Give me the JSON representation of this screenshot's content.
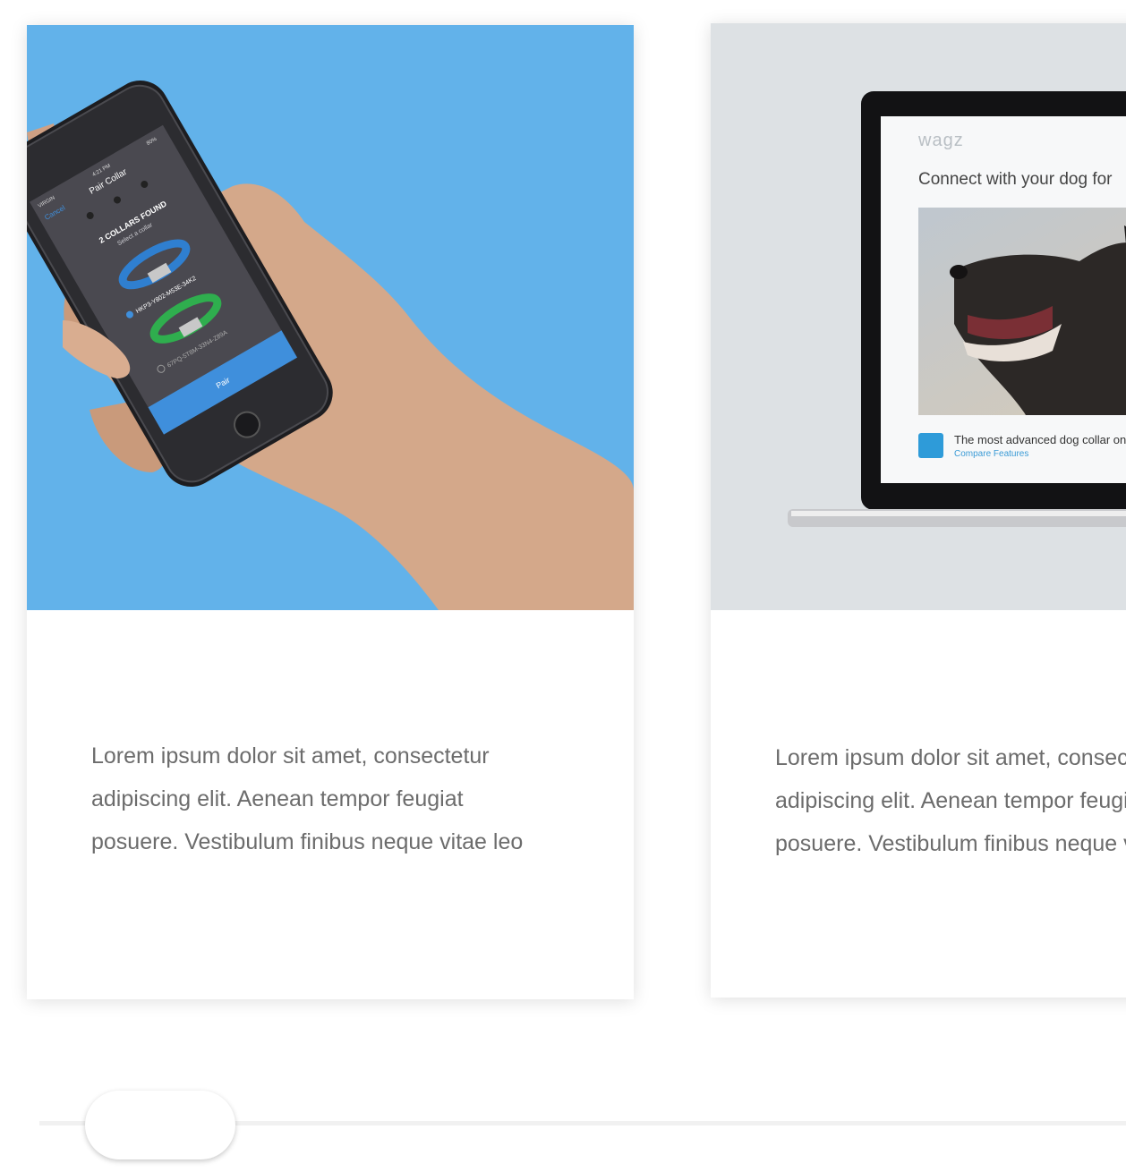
{
  "cards": [
    {
      "text_lines": [
        "Lorem ipsum dolor sit amet, consectetur",
        "adipiscing elit. Aenean tempor feugiat",
        "posuere. Vestibulum finibus neque vitae leo"
      ],
      "phone_screen": {
        "carrier": "VIRGIN",
        "time": "4:21 PM",
        "battery": "80%",
        "cancel_label": "Cancel",
        "title": "Pair Collar",
        "found_heading": "2 COLLARS FOUND",
        "select_hint": "Select a collar",
        "collars": [
          {
            "id": "HKP3-Y802-M53E-34K2",
            "color": "#2f7fd0",
            "selected": true
          },
          {
            "id": "67PQ-5T8M-33N4-Z89A",
            "color": "#2fae4e",
            "selected": false
          }
        ],
        "pair_label": "Pair"
      }
    },
    {
      "text_lines": [
        "Lorem ipsum dolor sit amet, consectetur",
        "adipiscing elit. Aenean tempor feugiat",
        "posuere. Vestibulum finibus neque vitae leo"
      ],
      "laptop_screen": {
        "logo": "wagz",
        "heading": "Connect with your dog for",
        "promo_text": "The most advanced dog collar on",
        "promo_link": "Compare Features"
      }
    }
  ],
  "colors": {
    "accent_blue": "#62b2ea",
    "card2_bg": "#dde1e4",
    "body_text": "#6c6c6c"
  },
  "slider": {
    "position": 0.04
  }
}
